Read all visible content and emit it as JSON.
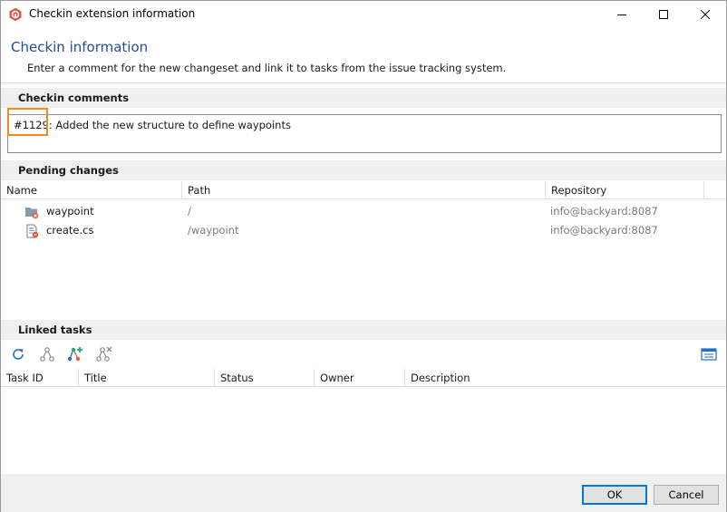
{
  "window": {
    "title": "Checkin extension information"
  },
  "header": {
    "title": "Checkin information",
    "description": "Enter a comment for the new changeset and link it to tasks from the issue tracking system."
  },
  "comments": {
    "section_label": "Checkin comments",
    "value": "#1129: Added the new structure to define waypoints"
  },
  "pending": {
    "section_label": "Pending changes",
    "columns": [
      "Name",
      "Path",
      "Repository"
    ],
    "rows": [
      {
        "name": "waypoint",
        "path": "/",
        "repository": "info@backyard:8087",
        "icon": "folder-icon"
      },
      {
        "name": "create.cs",
        "path": "/waypoint",
        "repository": "info@backyard:8087",
        "icon": "cs-file-icon"
      }
    ]
  },
  "linked": {
    "section_label": "Linked tasks",
    "columns": [
      "Task ID",
      "Title",
      "Status",
      "Owner",
      "Description"
    ],
    "toolbar": [
      "refresh-icon",
      "link-task-icon",
      "add-task-icon",
      "unlink-task-icon",
      "details-view-icon"
    ]
  },
  "footer": {
    "ok_label": "OK",
    "cancel_label": "Cancel"
  },
  "colors": {
    "accent": "#1f4e96",
    "highlight": "#f08a24",
    "brand": "#e8553f",
    "focus": "#0078d7"
  }
}
